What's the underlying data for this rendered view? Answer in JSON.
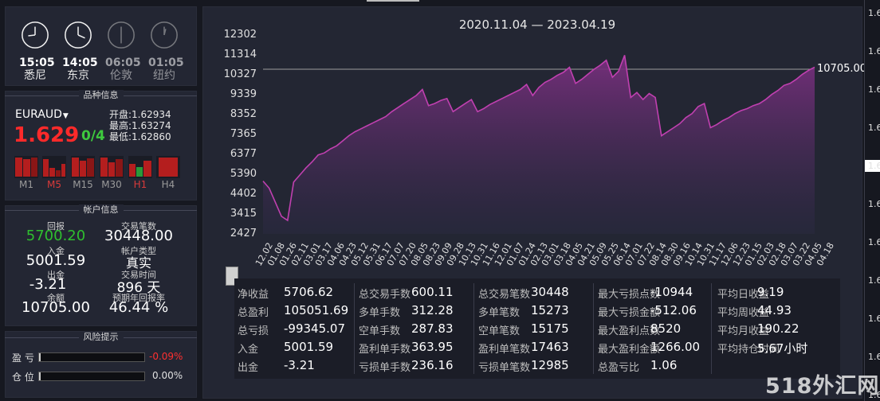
{
  "clocks": [
    {
      "time": "15:05",
      "city": "悉尼",
      "active": true
    },
    {
      "time": "14:05",
      "city": "东京",
      "active": true
    },
    {
      "time": "06:05",
      "city": "伦敦",
      "active": false
    },
    {
      "time": "01:05",
      "city": "纽约",
      "active": false
    }
  ],
  "product": {
    "header": "品种信息",
    "symbol": "EURAUD",
    "price_big": "1.629",
    "price_frac": "0/4",
    "open_label": "开盘:",
    "open": "1.62934",
    "high_label": "最高:",
    "high": "1.63274",
    "low_label": "最低:",
    "low": "1.62860",
    "timeframes": [
      "M1",
      "M5",
      "M15",
      "M30",
      "H1",
      "H4"
    ]
  },
  "account": {
    "header": "帐户信息",
    "return_label": "回报",
    "return_value": "5700.20",
    "trades_label": "交易笔数",
    "trades_value": "30448.00",
    "deposit_label": "入金",
    "deposit_value": "5001.59",
    "type_label": "帐户类型",
    "type_value": "真实",
    "withdraw_label": "出金",
    "withdraw_value": "-3.21",
    "time_label": "交易时间",
    "time_value": "896 天",
    "balance_label": "余额",
    "balance_value": "10705.00",
    "annual_label": "预期年回报率",
    "annual_value": "46.44 %"
  },
  "risk": {
    "header": "风险提示",
    "profit_label": "盈 亏",
    "profit_value": "-0.09%",
    "position_label": "仓 位",
    "position_value": "0.00%"
  },
  "chart_data": {
    "type": "area",
    "title": "2020.11.04 — 2023.04.19",
    "xlabel": "",
    "ylabel": "",
    "ylim": [
      2427,
      12302
    ],
    "y_ticks": [
      "12302",
      "11314",
      "10327",
      "9339",
      "8352",
      "7365",
      "6377",
      "5390",
      "4402",
      "3415",
      "2427"
    ],
    "x_ticks": [
      "12.02",
      "01.08",
      "01.26",
      "02.11",
      "03.01",
      "03.17",
      "04.06",
      "04.23",
      "05.12",
      "05.31",
      "06.17",
      "07.07",
      "07.20",
      "08.05",
      "08.23",
      "09.09",
      "09.28",
      "10.13",
      "10.31",
      "11.16",
      "12.01",
      "01.07",
      "01.24",
      "02.13",
      "03.01",
      "03.18",
      "04.05",
      "04.21",
      "05.09",
      "05.25",
      "06.14",
      "07.01",
      "07.22",
      "08.14",
      "08.30",
      "09.16",
      "10.14",
      "10.31",
      "11.17",
      "12.06",
      "12.23",
      "01.15",
      "02.03",
      "02.18",
      "03.07",
      "03.22",
      "04.05",
      "04.18"
    ],
    "last_value": "10705.00",
    "color": "#c040b0",
    "series": [
      {
        "values": [
          5050,
          4700,
          4000,
          3300,
          3100,
          5000,
          5350,
          5700,
          6000,
          6350,
          6450,
          6650,
          6800,
          7050,
          7300,
          7500,
          7650,
          7800,
          7950,
          8100,
          8250,
          8500,
          8700,
          8900,
          9100,
          9300,
          9600,
          8800,
          8900,
          9050,
          9150,
          8500,
          8700,
          8900,
          9100,
          8500,
          8650,
          8850,
          9000,
          9150,
          9300,
          9450,
          9600,
          9850,
          9300,
          9700,
          9950,
          10100,
          10300,
          10450,
          10700,
          9900,
          10100,
          10350,
          10600,
          10800,
          11050,
          10200,
          10500,
          11300,
          9200,
          9450,
          9100,
          9400,
          9200,
          7300,
          7500,
          7700,
          7900,
          8200,
          8400,
          8750,
          8900,
          7700,
          7850,
          8050,
          8200,
          8400,
          8550,
          8650,
          8800,
          8900,
          9100,
          9350,
          9550,
          9800,
          9900,
          10100,
          10350,
          10550,
          10705
        ]
      }
    ]
  },
  "stats": [
    [
      {
        "label": "净收益",
        "value": "5706.62"
      },
      {
        "label": "总盈利",
        "value": "105051.69"
      },
      {
        "label": "总亏损",
        "value": "-99345.07"
      },
      {
        "label": "入金",
        "value": "5001.59"
      },
      {
        "label": "出金",
        "value": "-3.21"
      }
    ],
    [
      {
        "label": "总交易手数",
        "value": "600.11"
      },
      {
        "label": "多单手数",
        "value": "312.28"
      },
      {
        "label": "空单手数",
        "value": "287.83"
      },
      {
        "label": "盈利单手数",
        "value": "363.95"
      },
      {
        "label": "亏损单手数",
        "value": "236.16"
      }
    ],
    [
      {
        "label": "总交易笔数",
        "value": "30448"
      },
      {
        "label": "多单笔数",
        "value": "15273"
      },
      {
        "label": "空单笔数",
        "value": "15175"
      },
      {
        "label": "盈利单笔数",
        "value": "17463"
      },
      {
        "label": "亏损单笔数",
        "value": "12985"
      }
    ],
    [
      {
        "label": "最大亏损点数",
        "value": "-10944"
      },
      {
        "label": "最大亏损金额",
        "value": "-512.06"
      },
      {
        "label": "最大盈利点数",
        "value": "8520"
      },
      {
        "label": "最大盈利金额",
        "value": "1266.00"
      },
      {
        "label": "总盈亏比",
        "value": "1.06"
      }
    ],
    [
      {
        "label": "平均日收益",
        "value": "9.19"
      },
      {
        "label": "平均周收益",
        "value": "44.93"
      },
      {
        "label": "平均月收益",
        "value": "190.22"
      },
      {
        "label": "平均持仓时间",
        "value": "5.67小时"
      }
    ]
  ],
  "right_axis": [
    "1.6",
    "1.6",
    "1.6",
    "1.6",
    "1.6",
    "1.6",
    "1.6",
    "1.6",
    "1.6",
    "1.6",
    "1.6"
  ],
  "watermark": "518外汇网"
}
